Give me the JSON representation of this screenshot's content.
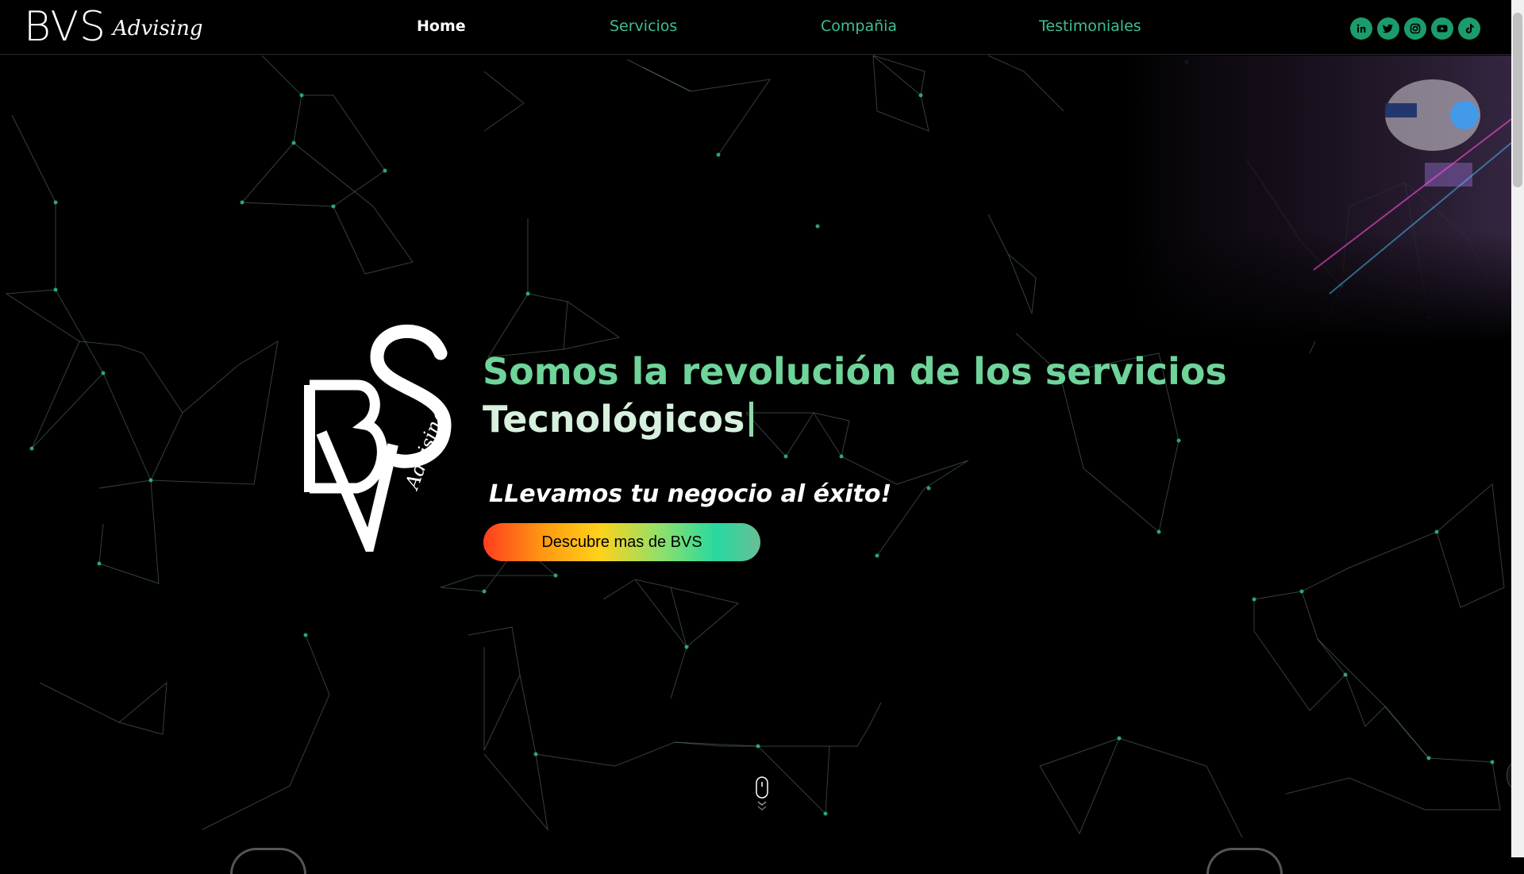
{
  "brand": {
    "name": "BVS",
    "script": "Advising"
  },
  "nav": [
    {
      "label": "Home",
      "active": true
    },
    {
      "label": "Servicios",
      "active": false
    },
    {
      "label": "Compañia",
      "active": false
    },
    {
      "label": "Testimoniales",
      "active": false
    }
  ],
  "social": [
    {
      "name": "linkedin-icon"
    },
    {
      "name": "twitter-icon"
    },
    {
      "name": "instagram-icon"
    },
    {
      "name": "youtube-icon"
    },
    {
      "name": "tiktok-icon"
    }
  ],
  "hero": {
    "headline_line1": "Somos la revolución de los servicios",
    "headline_line2": "Tecnológicos",
    "tagline": "LLevamos tu negocio al éxito!",
    "cta_label": "Descubre mas de BVS",
    "logo_script": "Advising"
  },
  "colors": {
    "accent_green": "#3fbf8f",
    "headline_green": "#6fd49a",
    "background": "#000000",
    "social_bg": "#1a9c6b"
  }
}
